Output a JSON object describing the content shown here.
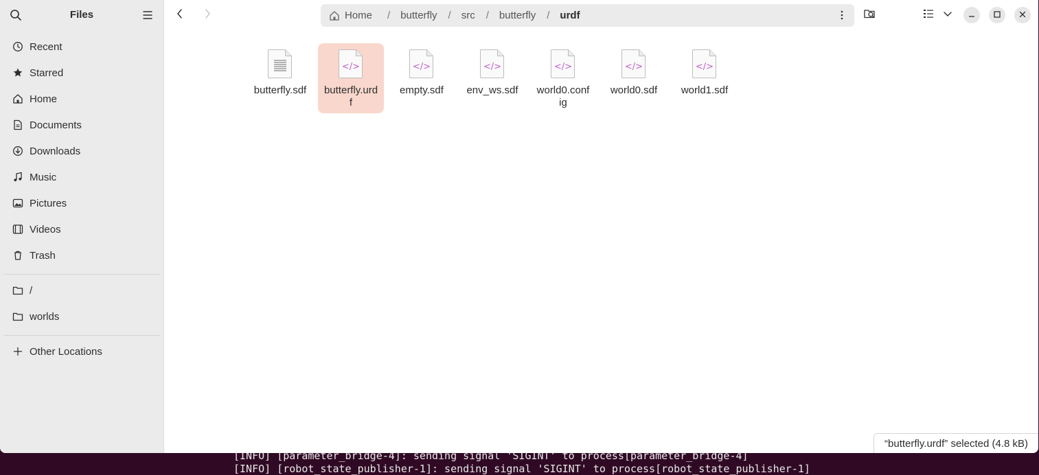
{
  "window": {
    "title": "Files"
  },
  "sidebar": {
    "items": [
      {
        "label": "Recent",
        "icon": "clock-icon"
      },
      {
        "label": "Starred",
        "icon": "star-icon"
      },
      {
        "label": "Home",
        "icon": "home-icon"
      },
      {
        "label": "Documents",
        "icon": "documents-icon"
      },
      {
        "label": "Downloads",
        "icon": "downloads-icon"
      },
      {
        "label": "Music",
        "icon": "music-icon"
      },
      {
        "label": "Pictures",
        "icon": "pictures-icon"
      },
      {
        "label": "Videos",
        "icon": "videos-icon"
      },
      {
        "label": "Trash",
        "icon": "trash-icon"
      }
    ],
    "places": [
      {
        "label": "/",
        "icon": "folder-icon"
      },
      {
        "label": "worlds",
        "icon": "folder-icon"
      }
    ],
    "other": {
      "label": "Other Locations",
      "icon": "plus-icon"
    }
  },
  "pathbar": {
    "crumbs": [
      "Home",
      "butterfly",
      "src",
      "butterfly",
      "urdf"
    ],
    "separator": "/"
  },
  "files": [
    {
      "name": "butterfly.sdf",
      "type": "text",
      "selected": false
    },
    {
      "name": "butterfly.urdf",
      "type": "code",
      "selected": true
    },
    {
      "name": "empty.sdf",
      "type": "code",
      "selected": false
    },
    {
      "name": "env_ws.sdf",
      "type": "code",
      "selected": false
    },
    {
      "name": "world0.config",
      "type": "code",
      "selected": false
    },
    {
      "name": "world0.sdf",
      "type": "code",
      "selected": false
    },
    {
      "name": "world1.sdf",
      "type": "code",
      "selected": false
    }
  ],
  "status": {
    "text": "“butterfly.urdf” selected  (4.8 kB)"
  },
  "terminal": {
    "line1": "[INFO] [parameter_bridge-4]: sending signal 'SIGINT' to process[parameter_bridge-4]",
    "line2": "[INFO] [robot_state_publisher-1]: sending signal 'SIGINT' to process[robot_state_publisher-1]"
  },
  "colors": {
    "selection": "#f9d7cc",
    "code_glyph": "#c061cb",
    "terminal_bg": "#300a24"
  }
}
